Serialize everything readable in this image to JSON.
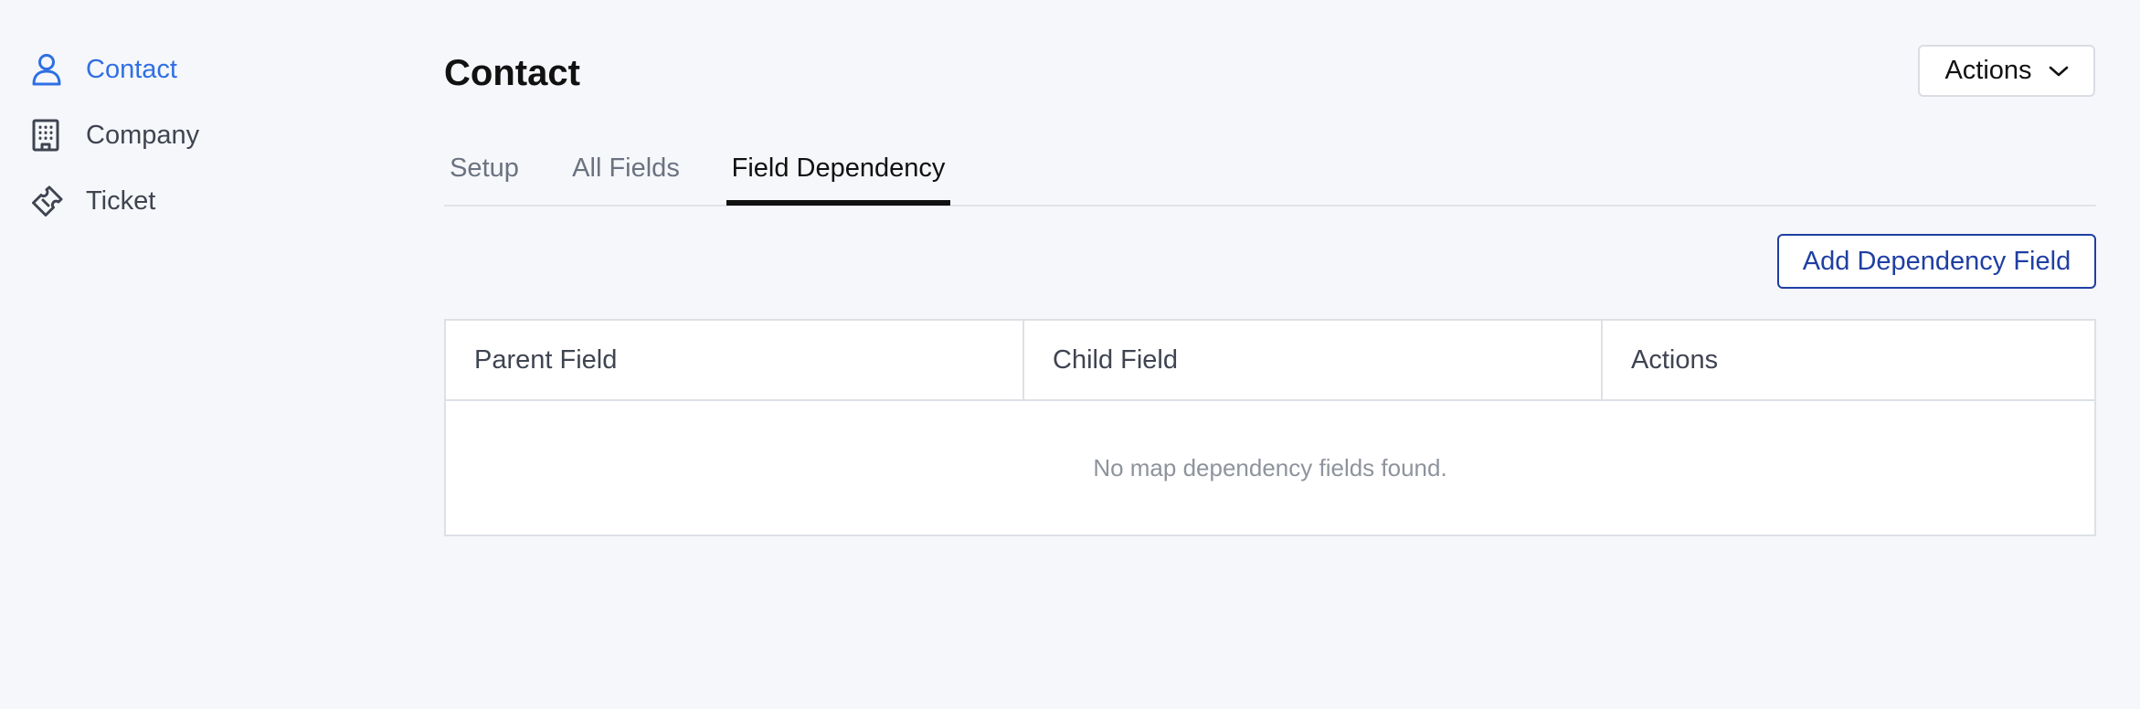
{
  "sidebar": {
    "items": [
      {
        "label": "Contact",
        "icon": "user-icon",
        "active": true
      },
      {
        "label": "Company",
        "icon": "building-icon",
        "active": false
      },
      {
        "label": "Ticket",
        "icon": "ticket-icon",
        "active": false
      }
    ]
  },
  "header": {
    "title": "Contact",
    "actions_label": "Actions"
  },
  "tabs": [
    {
      "label": "Setup",
      "active": false
    },
    {
      "label": "All Fields",
      "active": false
    },
    {
      "label": "Field Dependency",
      "active": true
    }
  ],
  "toolbar": {
    "add_label": "Add Dependency Field"
  },
  "table": {
    "columns": [
      "Parent Field",
      "Child Field",
      "Actions"
    ],
    "empty_message": "No map dependency fields found."
  },
  "colors": {
    "accent": "#2f6fe4",
    "primary_button": "#1f3fa3",
    "background": "#f6f7fa"
  }
}
